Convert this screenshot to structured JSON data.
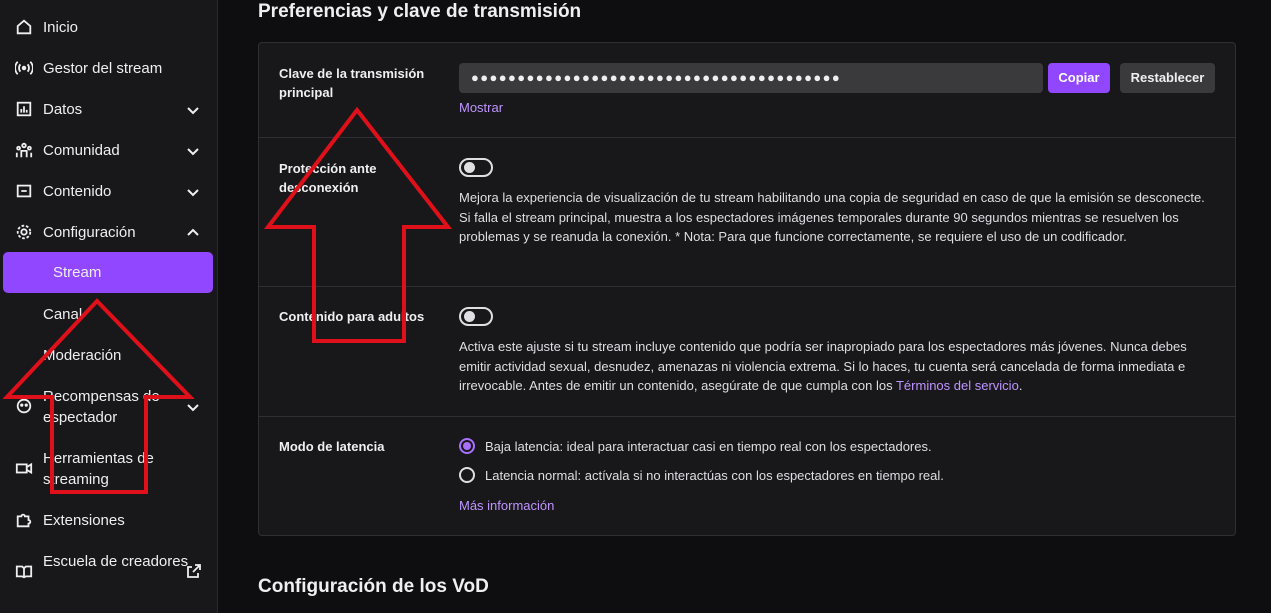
{
  "sidebar": {
    "items": [
      {
        "label": "Inicio",
        "icon": "home-icon"
      },
      {
        "label": "Gestor del stream",
        "icon": "broadcast-icon"
      },
      {
        "label": "Datos",
        "icon": "analytics-icon"
      },
      {
        "label": "Comunidad",
        "icon": "community-icon"
      },
      {
        "label": "Contenido",
        "icon": "content-icon"
      },
      {
        "label": "Configuración",
        "icon": "gear-icon"
      },
      {
        "label": "Stream"
      },
      {
        "label": "Canal"
      },
      {
        "label": "Moderación"
      },
      {
        "label": "Recompensas de espectador",
        "icon": "rewards-icon"
      },
      {
        "label": "Herramientas de streaming",
        "icon": "camera-icon"
      },
      {
        "label": "Extensiones",
        "icon": "puzzle-icon"
      },
      {
        "label": "Escuela de creadores",
        "icon": "book-icon"
      }
    ]
  },
  "main": {
    "section_title": "Preferencias y clave de transmisión",
    "stream_key": {
      "label": "Clave de la transmisión principal",
      "value": "●●●●●●●●●●●●●●●●●●●●●●●●●●●●●●●●●●●●●●●●",
      "copy_label": "Copiar",
      "reset_label": "Restablecer",
      "show_label": "Mostrar"
    },
    "disconnect_protection": {
      "label": "Protección ante desconexión",
      "enabled": false,
      "description": "Mejora la experiencia de visualización de tu stream habilitando una copia de seguridad en caso de que la emisión se desconecte. Si falla el stream principal, muestra a los espectadores imágenes temporales durante 90 segundos mientras se resuelven los problemas y se reanuda la conexión. * Nota: Para que funcione correctamente, se requiere el uso de un codificador."
    },
    "mature_content": {
      "label": "Contenido para adultos",
      "enabled": false,
      "description": "Activa este ajuste si tu stream incluye contenido que podría ser inapropiado para los espectadores más jóvenes. Nunca debes emitir actividad sexual, desnudez, amenazas ni violencia extrema. Si lo haces, tu cuenta será cancelada de forma inmediata e irrevocable. Antes de emitir un contenido, asegúrate de que cumpla con los ",
      "tos_link": "Términos del servicio",
      "tail": "."
    },
    "latency": {
      "label": "Modo de latencia",
      "options": [
        {
          "label": "Baja latencia: ideal para interactuar casi en tiempo real con los espectadores.",
          "selected": true
        },
        {
          "label": "Latencia normal: actívala si no interactúas con los espectadores en tiempo real.",
          "selected": false
        }
      ],
      "more_info": "Más información"
    },
    "vod_title": "Configuración de los VoD"
  },
  "colors": {
    "accent": "#9147ff",
    "link": "#bf94ff",
    "annotation": "#e0101a"
  }
}
